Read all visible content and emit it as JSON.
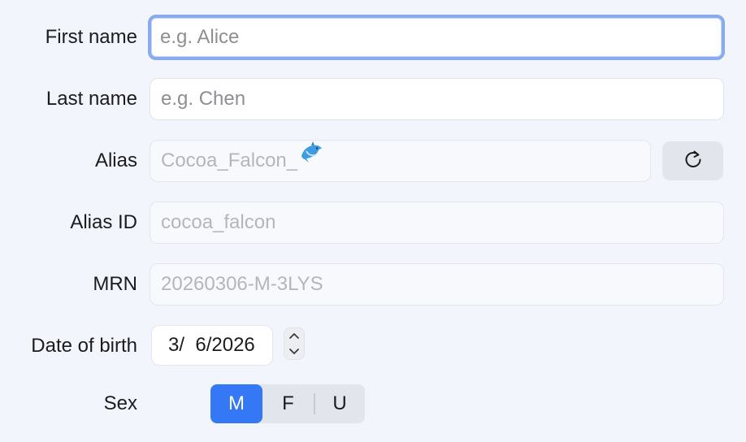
{
  "form": {
    "first_name": {
      "label": "First name",
      "placeholder": "e.g. Alice",
      "value": ""
    },
    "last_name": {
      "label": "Last name",
      "placeholder": "e.g. Chen",
      "value": ""
    },
    "alias": {
      "label": "Alias",
      "value": "Cocoa_Falcon_",
      "emoji": "dolphin-icon",
      "refresh_icon": "refresh-icon"
    },
    "alias_id": {
      "label": "Alias ID",
      "value": "cocoa_falcon"
    },
    "mrn": {
      "label": "MRN",
      "value": "20260306-M-3LYS"
    },
    "dob": {
      "label": "Date of birth",
      "value": "3/  6/2026",
      "stepper_icon": "up-down-chevron-icon"
    },
    "sex": {
      "label": "Sex",
      "options": [
        "M",
        "F",
        "U"
      ],
      "selected": "M"
    }
  },
  "colors": {
    "background": "#f2f6fc",
    "accent": "#3478f6",
    "focus_ring": "#8aaaf0",
    "readonly_text": "#b4b6bc"
  }
}
